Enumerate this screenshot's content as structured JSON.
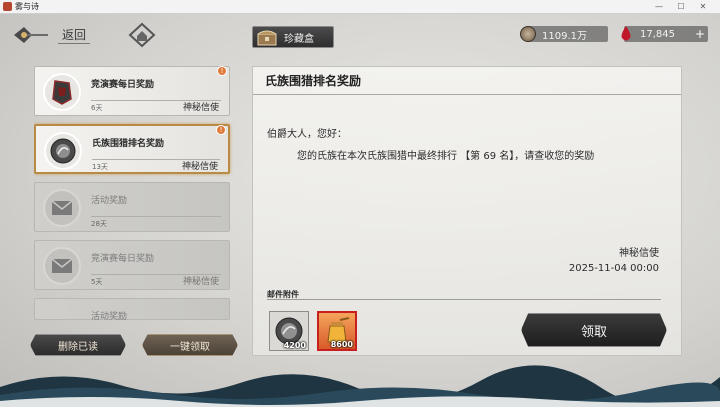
{
  "window": {
    "title": "雾与诗",
    "minimize": "—",
    "maximize": "☐",
    "close": "✕"
  },
  "topbar": {
    "back_label": "返回",
    "treasure_label": "珍藏盒",
    "silver_amount": "1109.1万",
    "blood_amount": "17,845",
    "plus": "+"
  },
  "mails": [
    {
      "title": "竞演赛每日奖励",
      "days": "6天",
      "sender": "神秘信使",
      "state": "unread",
      "badge": "!"
    },
    {
      "title": "氏族围猎排名奖励",
      "days": "13天",
      "sender": "神秘信使",
      "state": "selected",
      "badge": "!"
    },
    {
      "title": "活动奖励",
      "days": "28天",
      "sender": "",
      "state": "read"
    },
    {
      "title": "竞演赛每日奖励",
      "days": "5天",
      "sender": "神秘信使",
      "state": "read"
    },
    {
      "title": "活动奖励",
      "state": "read-partial"
    }
  ],
  "buttons": {
    "delete_read": "删除已读",
    "claim_all": "一键领取",
    "claim": "领取"
  },
  "detail": {
    "title": "氏族围猎排名奖励",
    "greeting": "伯爵大人，您好：",
    "body": "您的氏族在本次氏族围猎中最终排行 【第 69 名】，请查收您的奖励",
    "signature": "神秘信使",
    "date": "2025-11-04  00:00",
    "attachments_label": "邮件附件",
    "attachments": [
      {
        "name": "silver-coin-icon",
        "qty": "4200"
      },
      {
        "name": "honey-jar-icon",
        "qty": "8600"
      }
    ]
  },
  "colors": {
    "accent_gold": "#b88a45",
    "badge_orange": "#e07a3a",
    "blood_red": "#c0182a"
  }
}
